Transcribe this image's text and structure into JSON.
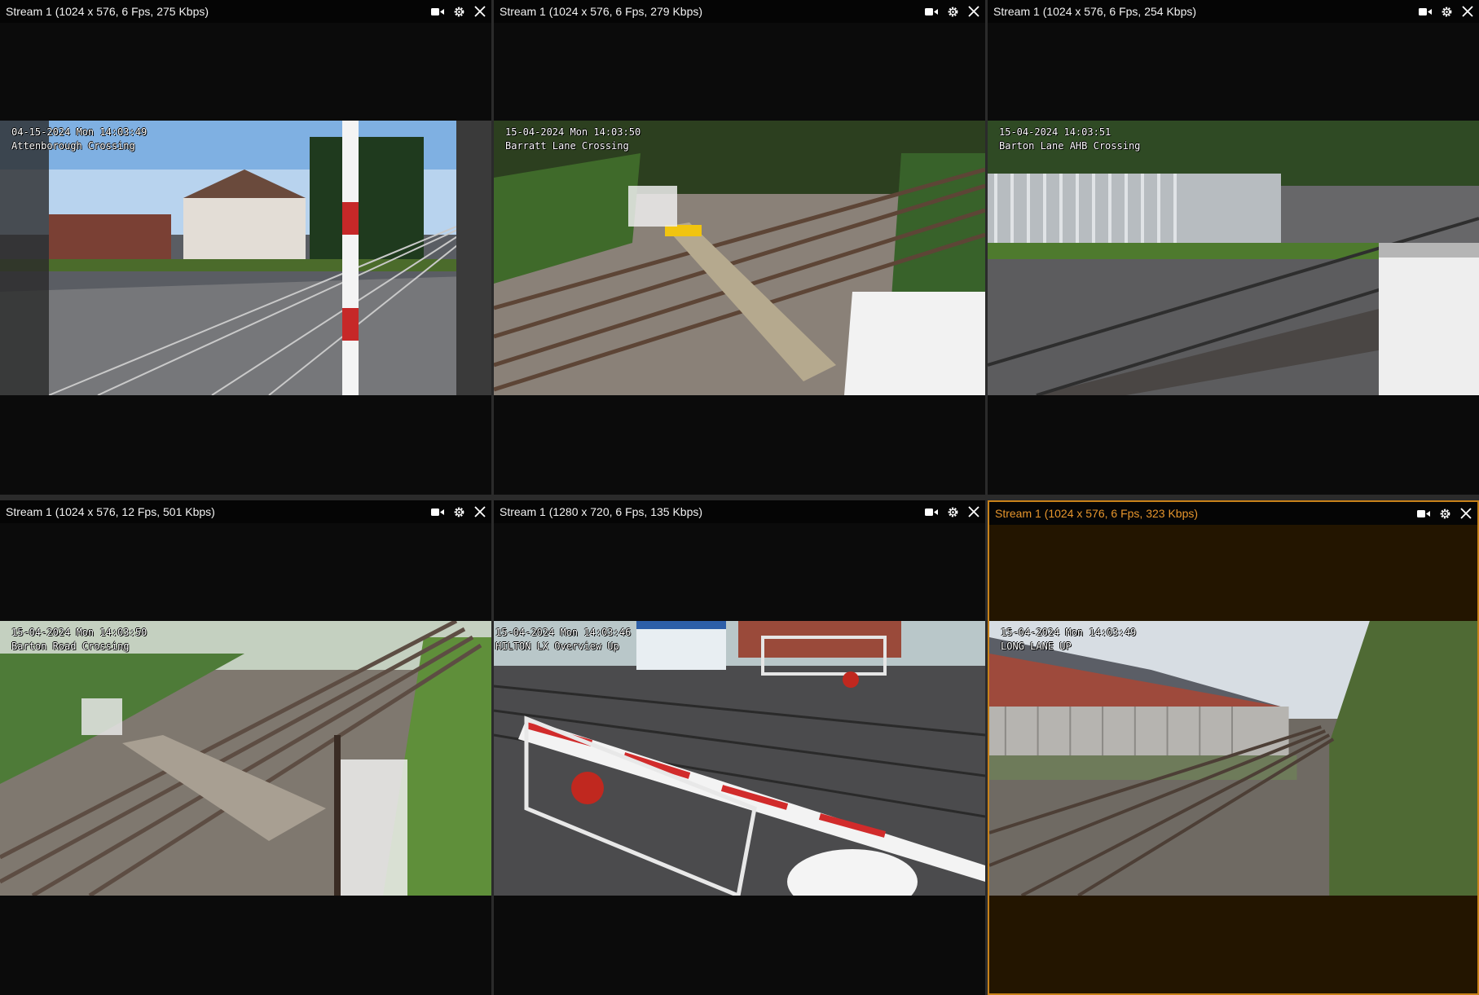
{
  "tiles": [
    {
      "title": "Stream 1 (1024 x 576, 6 Fps, 275 Kbps)",
      "osd_datetime": "04-15-2024 Mon 14:03:49",
      "osd_location": "Attenborough Crossing",
      "selected": false
    },
    {
      "title": "Stream 1 (1024 x 576, 6 Fps, 279 Kbps)",
      "osd_datetime": "15-04-2024 Mon 14:03:50",
      "osd_location": "Barratt Lane Crossing",
      "selected": false
    },
    {
      "title": "Stream 1 (1024 x 576, 6 Fps, 254 Kbps)",
      "osd_datetime": "15-04-2024 14:03:51",
      "osd_location": "Barton Lane AHB Crossing",
      "selected": false
    },
    {
      "title": "Stream 1 (1024 x 576, 12 Fps, 501 Kbps)",
      "osd_datetime": "15-04-2024 Mon 14:03:50",
      "osd_location": "Barton Road Crossing",
      "selected": false
    },
    {
      "title": "Stream 1 (1280 x 720, 6 Fps, 135 Kbps)",
      "osd_datetime": "15-04-2024 Mon 14:03:46",
      "osd_location": "HILTON LX Overview Up",
      "selected": false
    },
    {
      "title": "Stream 1 (1024 x 576, 6 Fps, 323 Kbps)",
      "osd_datetime": "15-04-2024 Mon 14:03:49",
      "osd_location": "LONG LANE UP",
      "selected": true
    }
  ],
  "icons": {
    "record": "video-camera-icon",
    "settings": "gear-icon",
    "close": "close-icon"
  },
  "colors": {
    "selected_accent": "#c8821a",
    "selected_title": "#e6952c",
    "tile_bg": "#0b0b0b",
    "selected_bg": "#231500"
  }
}
